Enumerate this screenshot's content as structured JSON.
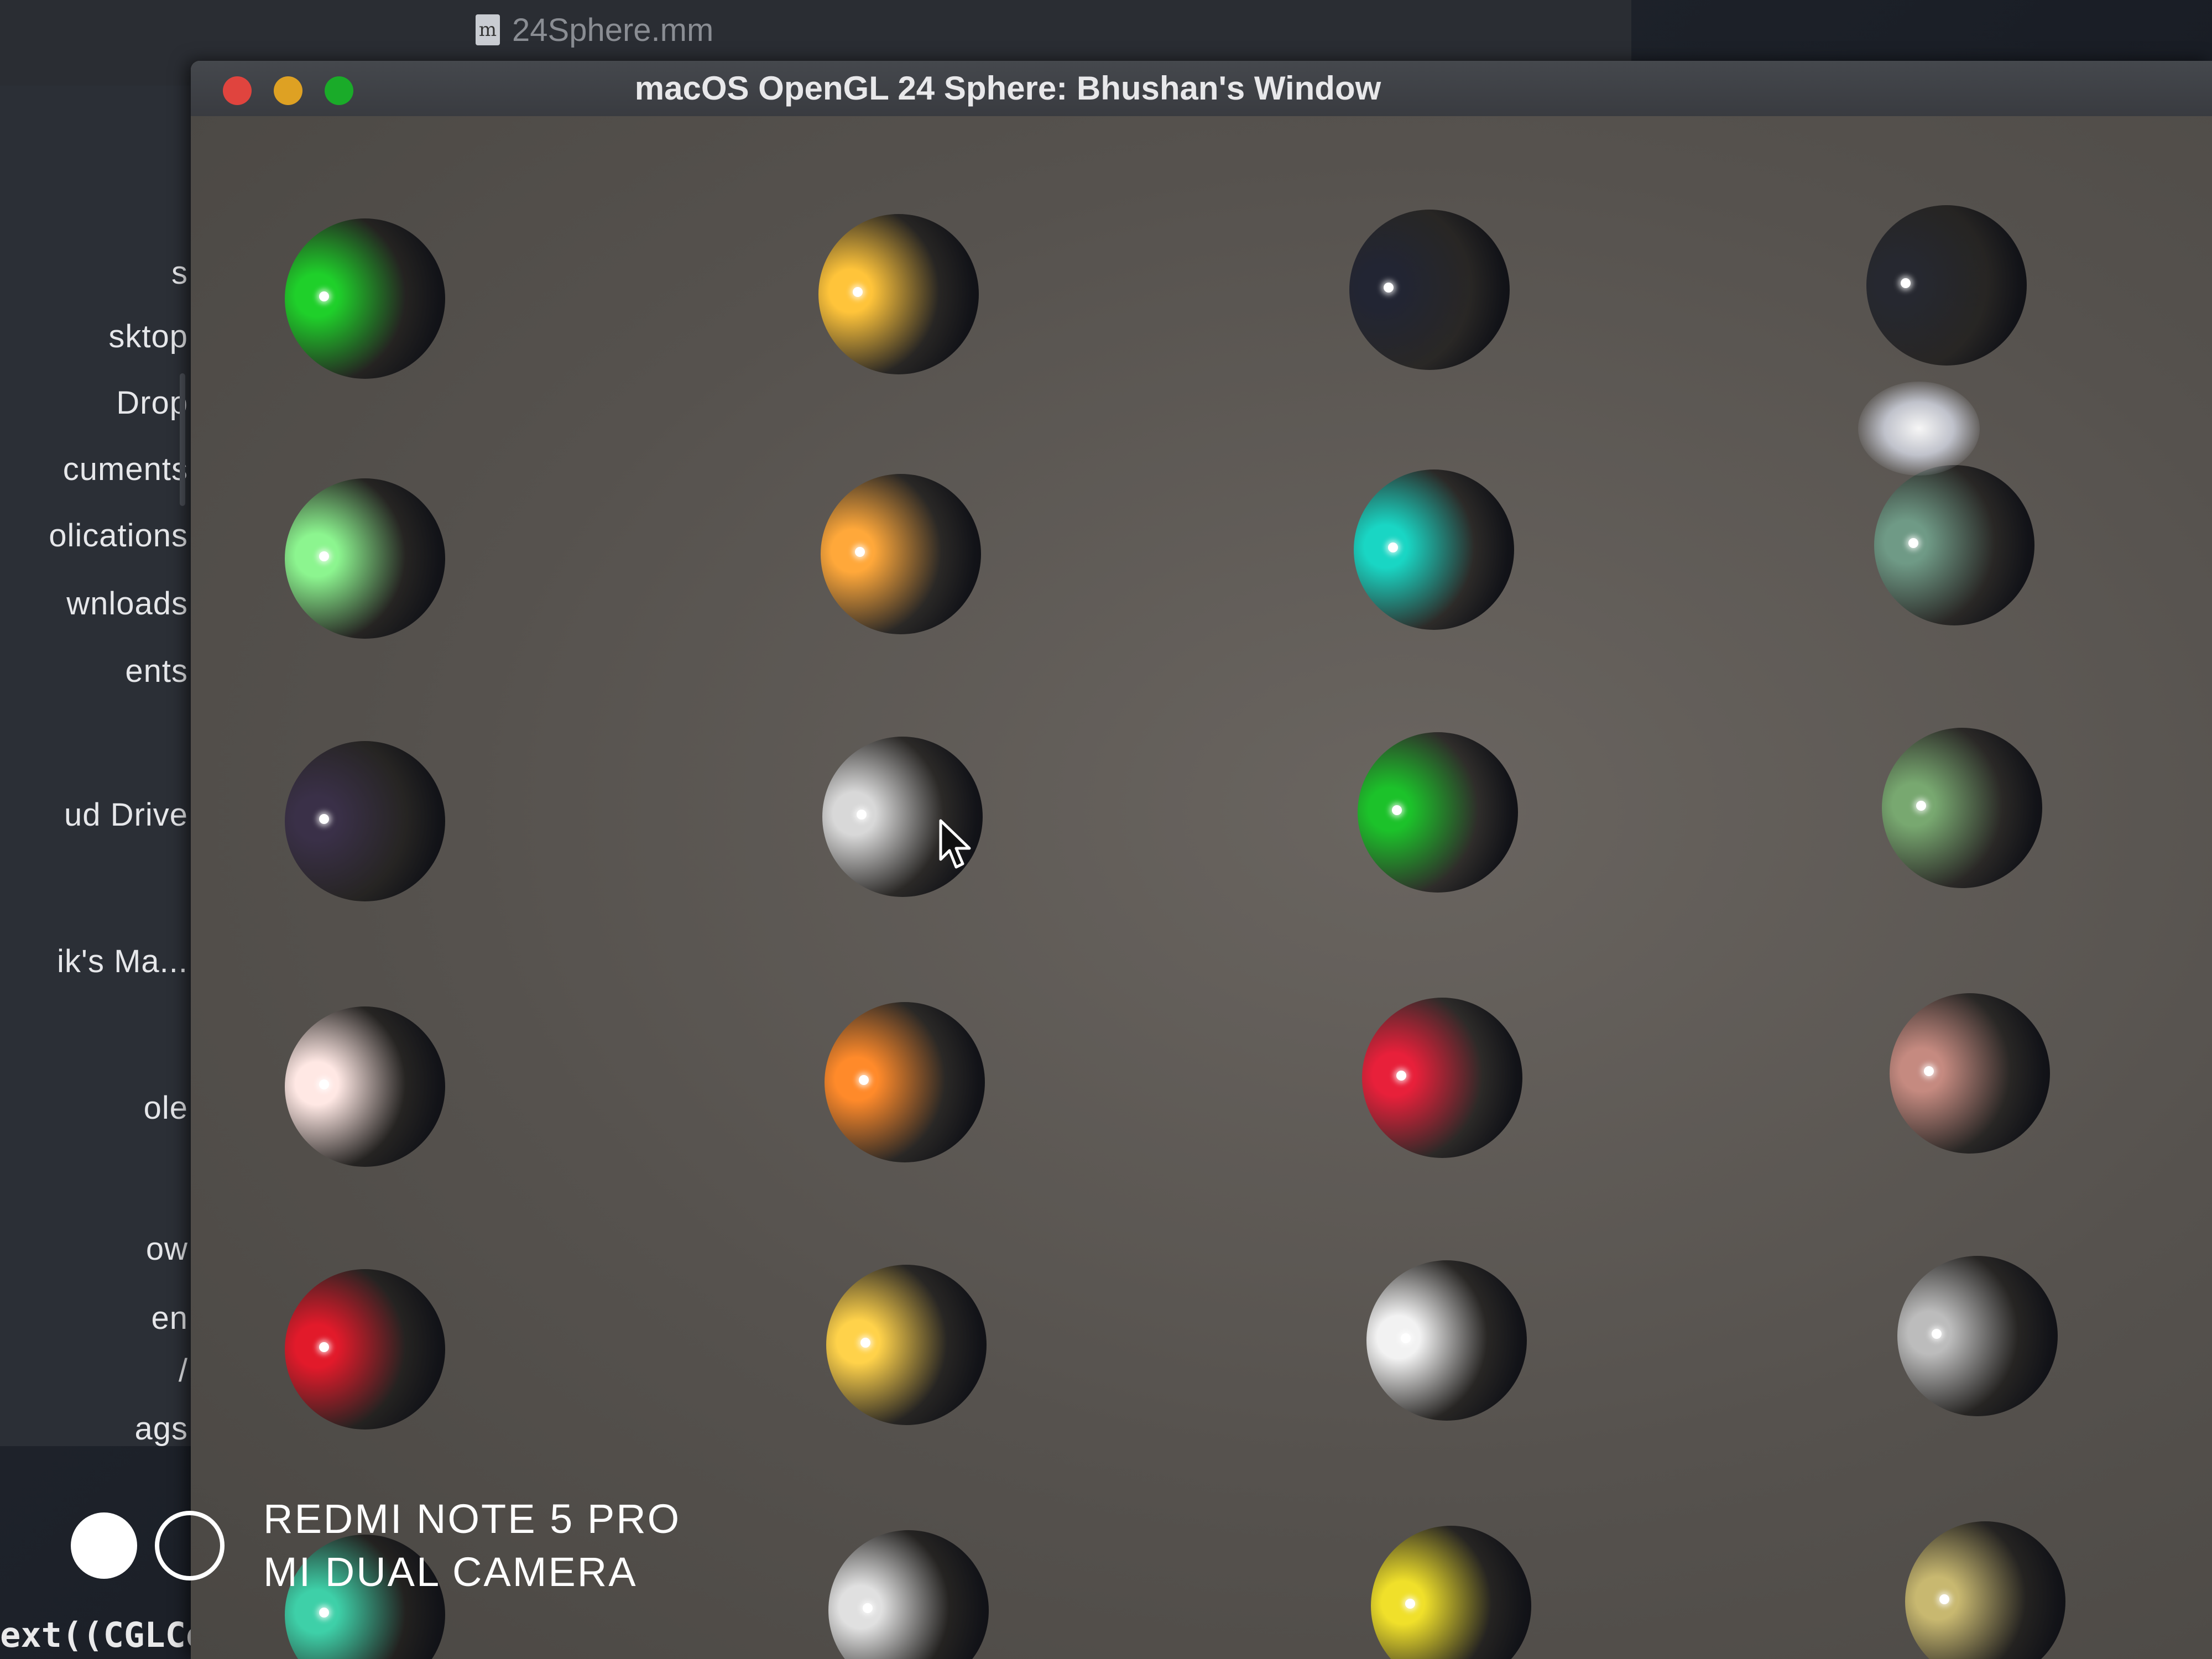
{
  "editor": {
    "tab_icon": "m",
    "tab_title": "24Sphere.mm"
  },
  "finder_sidebar": {
    "items": [
      "s",
      "sktop",
      "Drop",
      "cuments",
      "olications",
      "wnloads",
      "ents",
      "ud Drive",
      "ik's Ma...",
      "ole",
      "ow",
      "en",
      "/",
      "ags"
    ]
  },
  "code_fragment": "ext((CGLCo",
  "gl_window": {
    "title": "macOS OpenGL 24 Sphere:  Bhushan's Window",
    "buttons": {
      "close_color": "#e0443e",
      "minimize_color": "#dea123",
      "zoom_color": "#1aab29"
    }
  },
  "spheres": [
    {
      "row": 1,
      "col": 1,
      "color": "#1fd02a",
      "material": "emerald"
    },
    {
      "row": 1,
      "col": 2,
      "color": "#ffc43a",
      "material": "brass"
    },
    {
      "row": 1,
      "col": 3,
      "color": "#222533",
      "material": "black plastic"
    },
    {
      "row": 1,
      "col": 4,
      "color": "#262830",
      "material": "black rubber"
    },
    {
      "row": 2,
      "col": 1,
      "color": "#8cf58f",
      "material": "jade"
    },
    {
      "row": 2,
      "col": 2,
      "color": "#ffa83a",
      "material": "bronze"
    },
    {
      "row": 2,
      "col": 3,
      "color": "#19d6c4",
      "material": "cyan plastic"
    },
    {
      "row": 2,
      "col": 4,
      "color": "#6f9a86",
      "material": "cyan rubber"
    },
    {
      "row": 3,
      "col": 1,
      "color": "#3a3048",
      "material": "obsidian"
    },
    {
      "row": 3,
      "col": 2,
      "color": "#d8d8d8",
      "material": "chrome"
    },
    {
      "row": 3,
      "col": 3,
      "color": "#1cc22a",
      "material": "green plastic"
    },
    {
      "row": 3,
      "col": 4,
      "color": "#78a870",
      "material": "green rubber"
    },
    {
      "row": 4,
      "col": 1,
      "color": "#ffe8e4",
      "material": "pearl"
    },
    {
      "row": 4,
      "col": 2,
      "color": "#ff8a2a",
      "material": "copper"
    },
    {
      "row": 4,
      "col": 3,
      "color": "#e8203a",
      "material": "red plastic"
    },
    {
      "row": 4,
      "col": 4,
      "color": "#c58a80",
      "material": "red rubber"
    },
    {
      "row": 5,
      "col": 1,
      "color": "#e21a2a",
      "material": "ruby"
    },
    {
      "row": 5,
      "col": 2,
      "color": "#ffd24a",
      "material": "gold"
    },
    {
      "row": 5,
      "col": 3,
      "color": "#f2f2f2",
      "material": "white plastic"
    },
    {
      "row": 5,
      "col": 4,
      "color": "#bcbcbc",
      "material": "white rubber"
    },
    {
      "row": 6,
      "col": 1,
      "color": "#3ed0a8",
      "material": "turquoise"
    },
    {
      "row": 6,
      "col": 2,
      "color": "#e0e0e0",
      "material": "silver"
    },
    {
      "row": 6,
      "col": 3,
      "color": "#f0e02a",
      "material": "yellow plastic"
    },
    {
      "row": 6,
      "col": 4,
      "color": "#c8b870",
      "material": "yellow rubber"
    }
  ],
  "camera_watermark": {
    "line1": "REDMI NOTE 5 PRO",
    "line2": "MI DUAL CAMERA"
  }
}
